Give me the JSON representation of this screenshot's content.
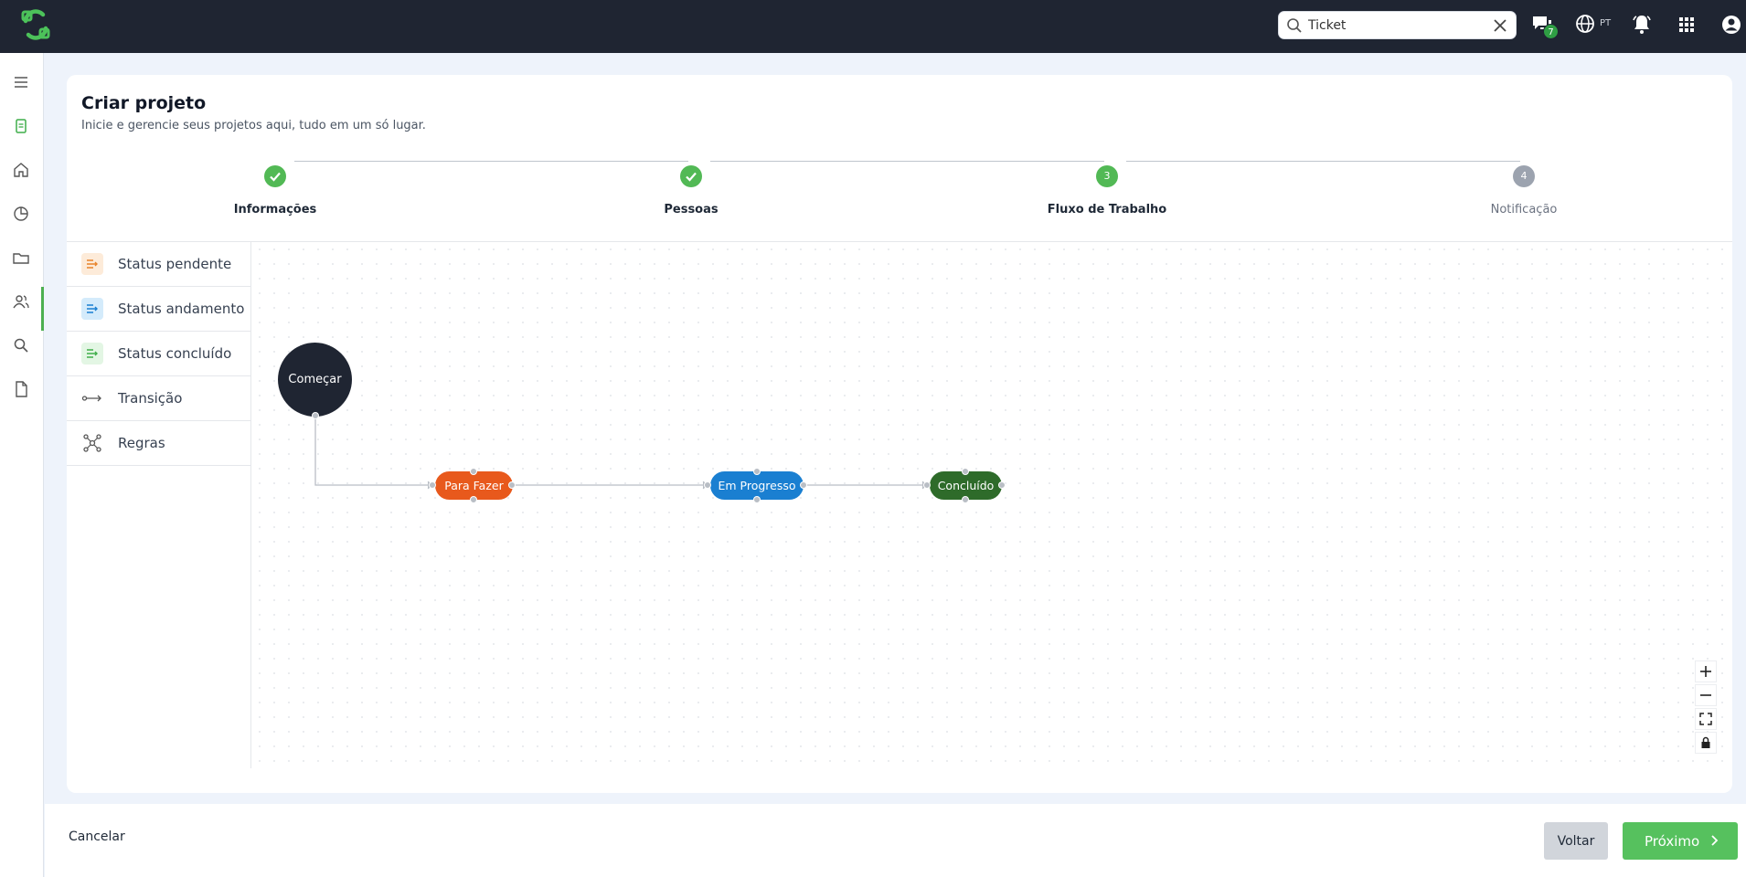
{
  "app": {
    "search": {
      "value": "Ticket",
      "placeholder": ""
    },
    "chat_badge": "7",
    "language": "PT"
  },
  "page": {
    "title": "Criar projeto",
    "subtitle": "Inicie e gerencie seus projetos aqui, tudo em um só lugar."
  },
  "stepper": {
    "steps": [
      {
        "label": "Informações",
        "number": "1",
        "state": "complete"
      },
      {
        "label": "Pessoas",
        "number": "2",
        "state": "complete"
      },
      {
        "label": "Fluxo de Trabalho",
        "number": "3",
        "state": "current"
      },
      {
        "label": "Notificação",
        "number": "4",
        "state": "pending"
      }
    ]
  },
  "palette": {
    "items": [
      {
        "label": "Status pendente",
        "icon": "status-pending-icon"
      },
      {
        "label": "Status andamento",
        "icon": "status-progress-icon"
      },
      {
        "label": "Status concluído",
        "icon": "status-done-icon"
      },
      {
        "label": "Transição",
        "icon": "transition-icon"
      },
      {
        "label": "Regras",
        "icon": "rules-icon"
      }
    ]
  },
  "workflow": {
    "nodes": [
      {
        "label": "Começar",
        "color": "#1f2532"
      },
      {
        "label": "Para Fazer",
        "color": "#e8591c"
      },
      {
        "label": "Em Progresso",
        "color": "#1a7fd1"
      },
      {
        "label": "Concluído",
        "color": "#2e6b2a"
      }
    ]
  },
  "footer": {
    "cancel": "Cancelar",
    "back": "Voltar",
    "next": "Próximo"
  },
  "colors": {
    "topbar": "#1f2532",
    "accent": "#56c15e",
    "step_complete": "#52b955",
    "step_pending": "#9ca3af"
  }
}
